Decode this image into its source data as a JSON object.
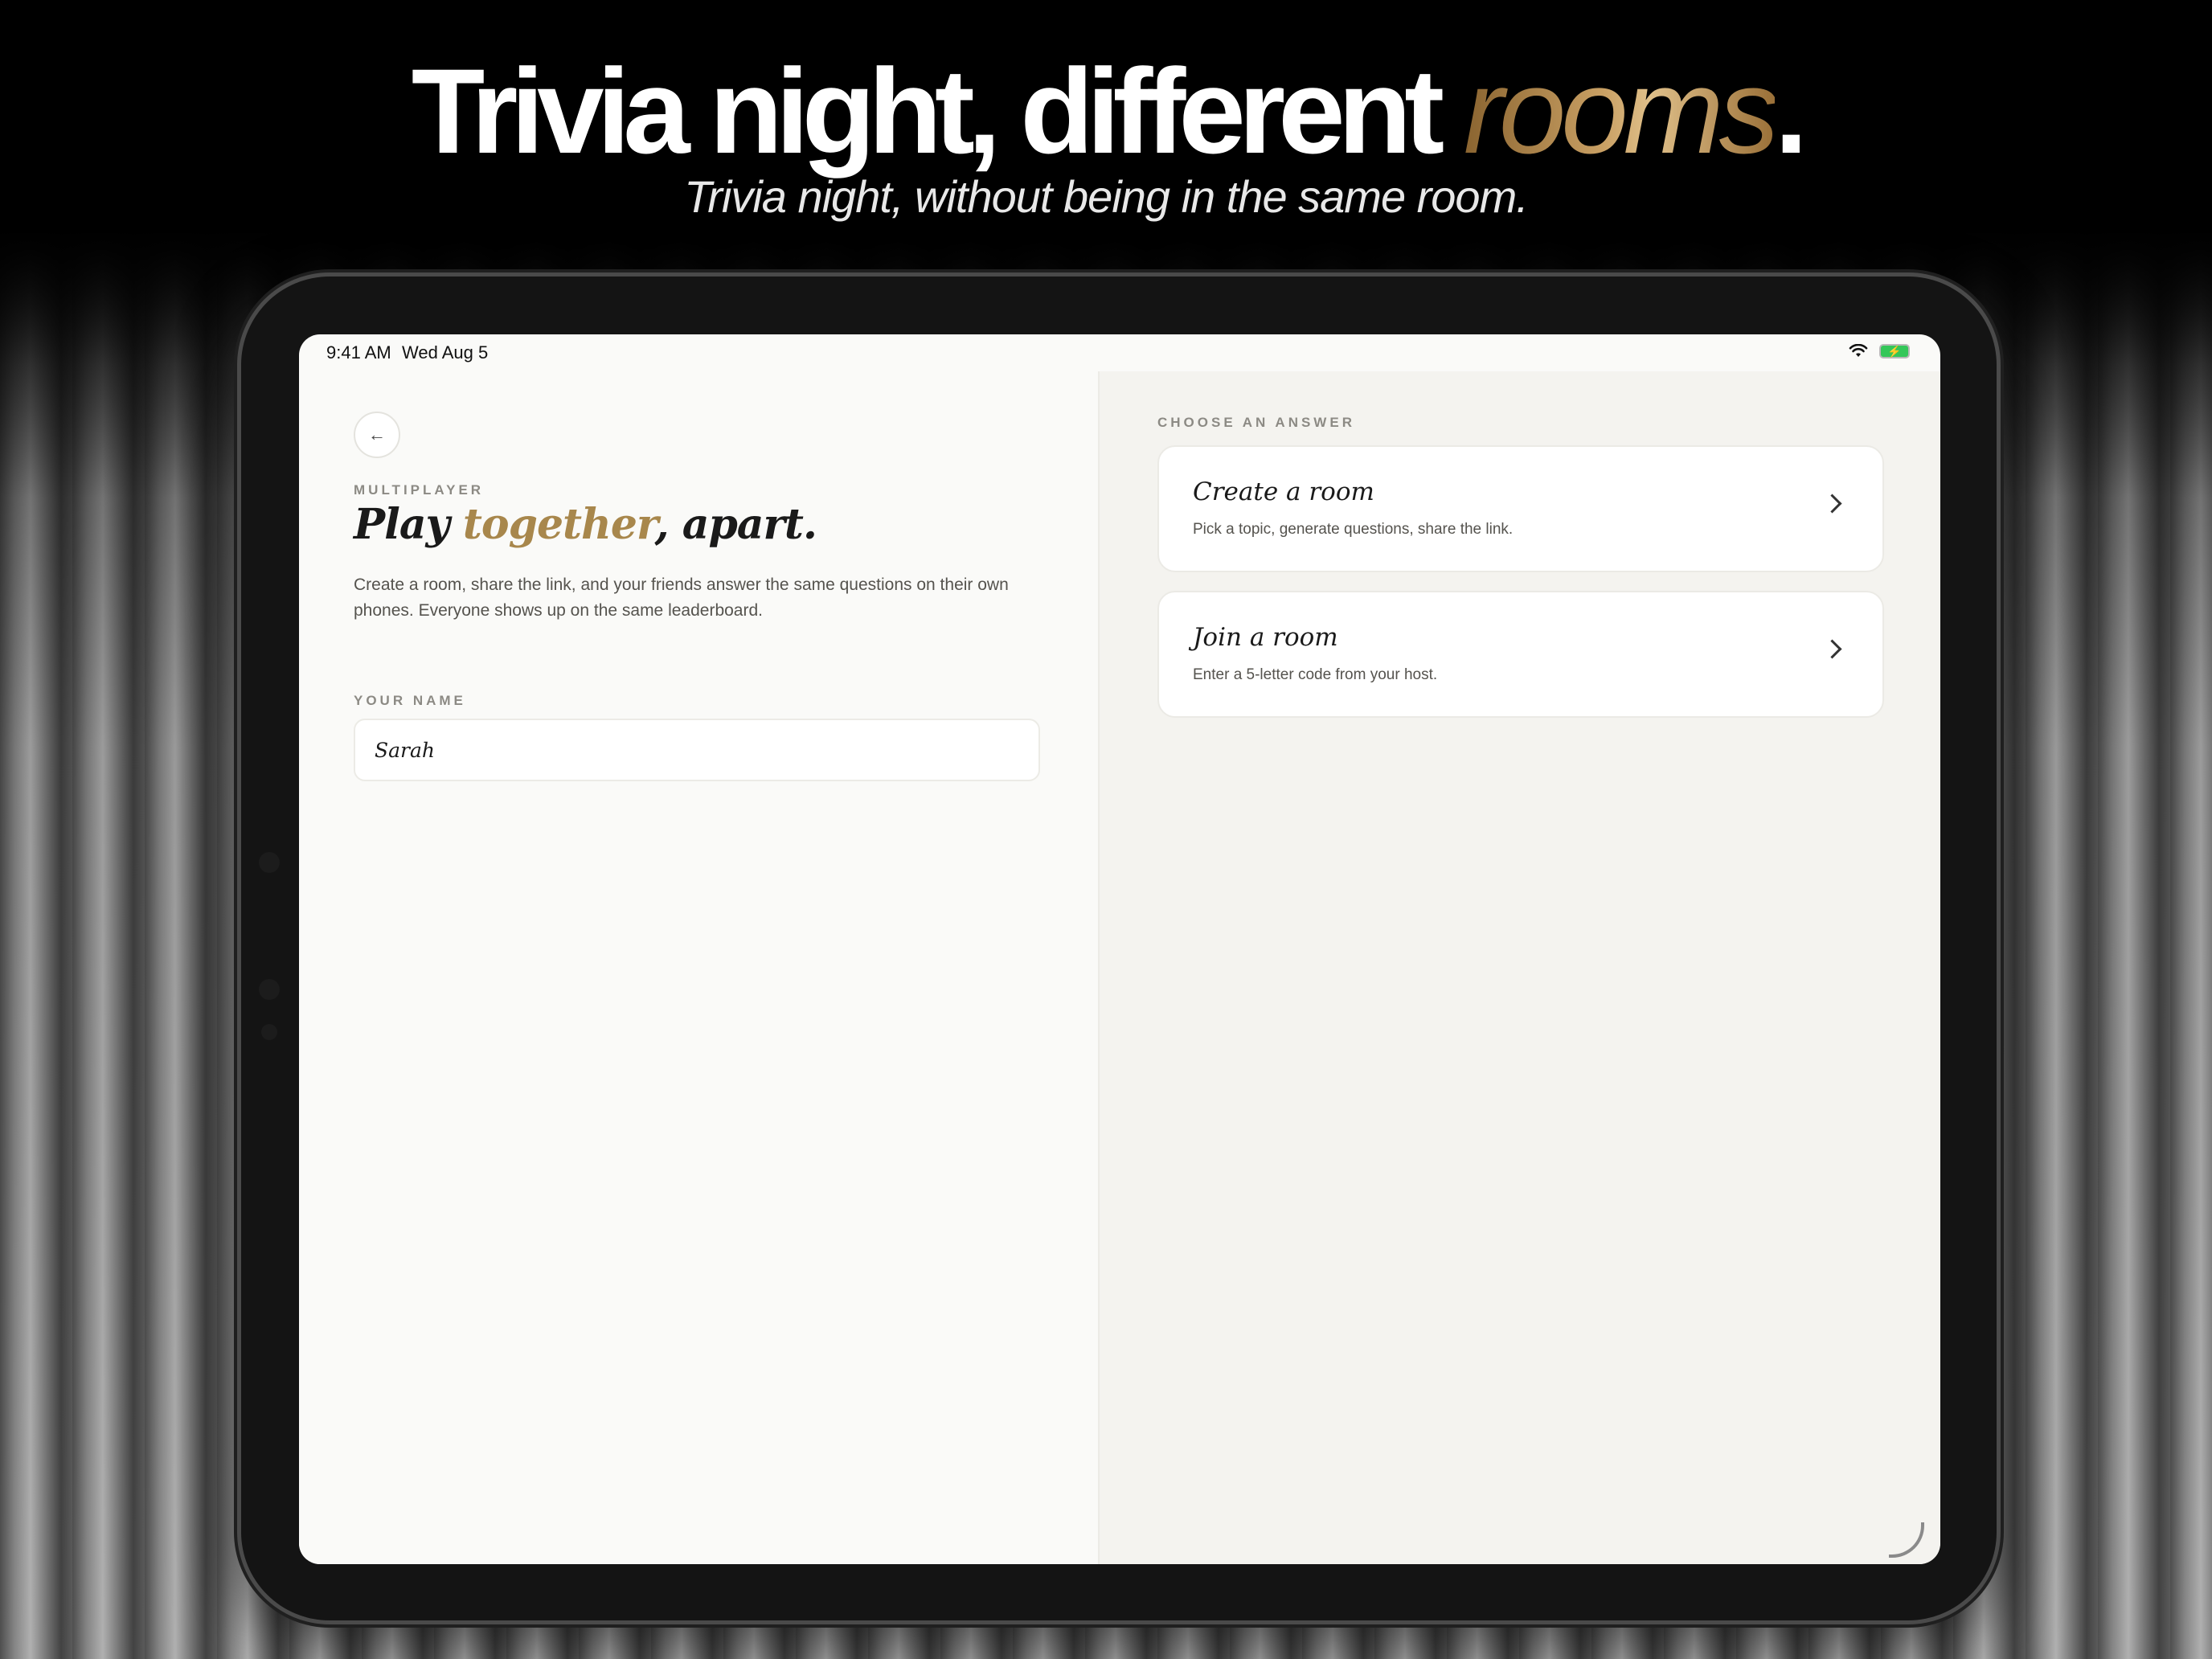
{
  "marketing": {
    "headline_main": "Trivia night, different ",
    "headline_accent": "rooms",
    "headline_period": ".",
    "subheadline": "Trivia night, without being in the same room."
  },
  "statusbar": {
    "time": "9:41 AM",
    "date": "Wed Aug 5",
    "wifi_icon": "wifi-icon",
    "battery_icon": "battery-charging-icon"
  },
  "left": {
    "back_icon": "arrow-left-icon",
    "back_glyph": "←",
    "eyebrow": "MULTIPLAYER",
    "title_pre": "Play ",
    "title_accent": "together",
    "title_post": ", apart.",
    "description": "Create a room, share the link, and your friends answer the same questions on their own phones. Everyone shows up on the same leaderboard.",
    "name_label": "YOUR NAME",
    "name_value": "Sarah"
  },
  "right": {
    "eyebrow": "CHOOSE AN ANSWER",
    "options": [
      {
        "title": "Create a room",
        "subtitle": "Pick a topic, generate questions, share the link.",
        "icon": "chevron-right-icon"
      },
      {
        "title": "Join a room",
        "subtitle": "Enter a 5-letter code from your host.",
        "icon": "chevron-right-icon"
      }
    ]
  },
  "colors": {
    "accent_gold": "#a8874c",
    "pane_left": "#fafaf8",
    "pane_right": "#f4f3ef",
    "text_primary": "#1a1a1a"
  }
}
